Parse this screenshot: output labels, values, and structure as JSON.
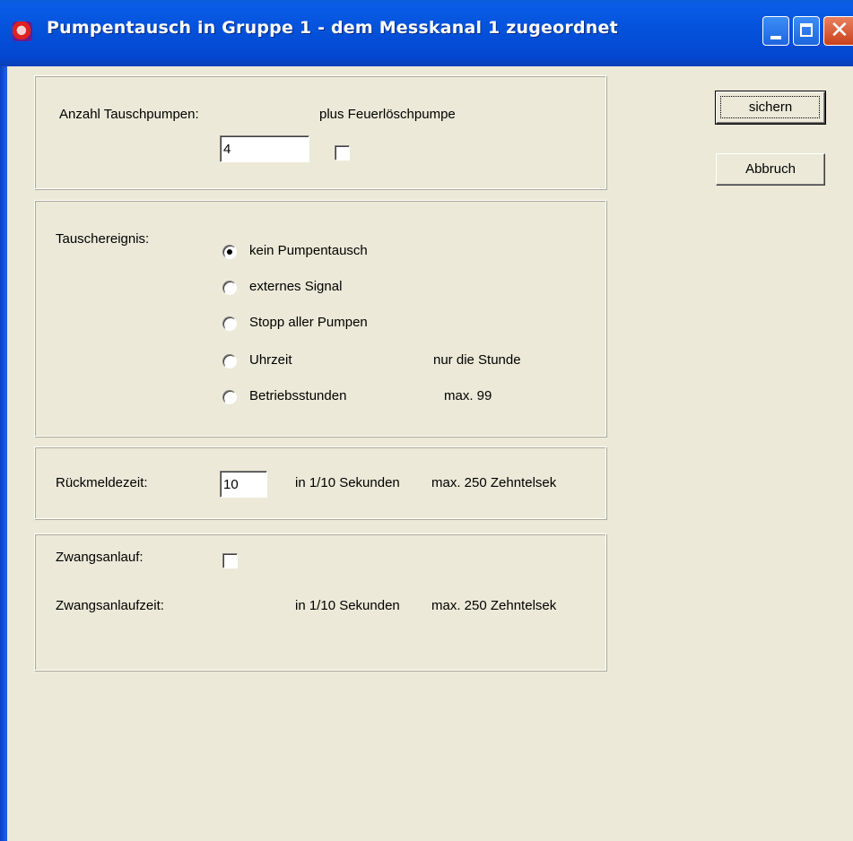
{
  "window": {
    "title": "Pumpentausch in Gruppe 1 - dem Messkanal 1 zugeordnet",
    "app_icon": "app-logo-icon",
    "controls": {
      "minimize": "minimize-icon",
      "maximize": "maximize-icon",
      "close": "close-icon",
      "close_glyph": "✕"
    }
  },
  "pump_count": {
    "label": "Anzahl Tauschpumpen:",
    "value": "4",
    "fire_pump_label": "plus Feuerlöschpumpe",
    "fire_pump_checked": false
  },
  "exchange_event": {
    "label": "Tauschereignis:",
    "options": [
      {
        "label": "kein Pumpentausch",
        "selected": true,
        "note": ""
      },
      {
        "label": "externes Signal",
        "selected": false,
        "note": ""
      },
      {
        "label": "Stopp aller Pumpen",
        "selected": false,
        "note": ""
      },
      {
        "label": "Uhrzeit",
        "selected": false,
        "note": "nur die Stunde"
      },
      {
        "label": "Betriebsstunden",
        "selected": false,
        "note": "max. 99"
      }
    ]
  },
  "feedback_time": {
    "label": "Rückmeldezeit:",
    "value": "10",
    "unit": "in 1/10 Sekunden",
    "max": "max. 250 Zehntelsek"
  },
  "forced_start": {
    "label": "Zwangsanlauf:",
    "checked": false,
    "time_label": "Zwangsanlaufzeit:",
    "unit": "in 1/10 Sekunden",
    "max": "max. 250 Zehntelsek"
  },
  "buttons": {
    "save": "sichern",
    "cancel": "Abbruch"
  },
  "colors": {
    "titlebar": "#0553dc",
    "dialog_bg": "#ece9d8",
    "close_button": "#c9421d"
  }
}
